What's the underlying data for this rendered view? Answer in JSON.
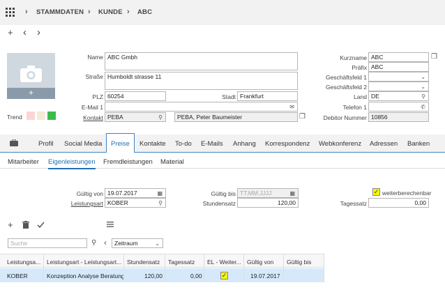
{
  "breadcrumb": {
    "items": [
      "STAMMDATEN",
      "KUNDE",
      "ABC"
    ]
  },
  "toolbar": {
    "add": "+",
    "back": "‹",
    "forward": "›"
  },
  "form": {
    "name_label": "Name",
    "name_value": "ABC Gmbh",
    "strasse_label": "Straße",
    "strasse_value": "Humboldt strasse 11",
    "plz_label": "PLZ",
    "plz_value": "60254",
    "stadt_label": "Stadt",
    "stadt_value": "Frankfurt",
    "email_label": "E-Mail 1",
    "email_value": "",
    "kontakt_label": "Kontakt",
    "kontakt_value": "PEBA",
    "kontakt_name": "PEBA, Peter Baumeister",
    "trend_label": "Trend",
    "kurzname_label": "Kurzname",
    "kurzname_value": "ABC",
    "praefix_label": "Präfix",
    "praefix_value": "ABC",
    "gf1_label": "Geschäftsfeld 1",
    "gf1_value": "",
    "gf2_label": "Geschäftsfeld 2",
    "gf2_value": "",
    "land_label": "Land",
    "land_value": "DE",
    "telefon_label": "Telefon 1",
    "telefon_value": "",
    "debitor_label": "Debitor Nummer",
    "debitor_value": "10856"
  },
  "tabs": [
    "Profil",
    "Social Media",
    "Preise",
    "Kontakte",
    "To-do",
    "E-Mails",
    "Anhang",
    "Korrespondenz",
    "Webkonferenz",
    "Adressen",
    "Banken"
  ],
  "subtabs": [
    "Mitarbeiter",
    "Eigenleistungen",
    "Fremdleistungen",
    "Material"
  ],
  "detail": {
    "gueltig_von_label": "Gültig von",
    "gueltig_von_value": "19.07.2017",
    "gueltig_bis_label": "Gültig bis",
    "gueltig_bis_placeholder": "TT.MM.JJJJ",
    "weiter_label": "weiterberechenbar",
    "weiter_checked": "✓",
    "leistungsart_label": "Leistungsart",
    "leistungsart_value": "KOBER",
    "stundensatz_label": "Stundensatz",
    "stundensatz_value": "120,00",
    "tagessatz_label": "Tagessatz",
    "tagessatz_value": "0,00"
  },
  "search": {
    "placeholder": "Suche",
    "zeitraum": "Zeitraum"
  },
  "table": {
    "headers": [
      "Leistungsa...",
      "Leistungsart - Leistungsart...",
      "Stundensatz",
      "Tagessatz",
      "EL - Weiter...",
      "Gültig von",
      "Gültig bis"
    ],
    "rows": [
      [
        "KOBER",
        "Konzeption Analyse Beratung",
        "120,00",
        "0,00",
        "✓",
        "19.07.2017",
        ""
      ]
    ]
  },
  "colors": {
    "accent": "#1f6fb5",
    "selected_row": "#d6e9fb",
    "highlight": "#f7f700"
  }
}
